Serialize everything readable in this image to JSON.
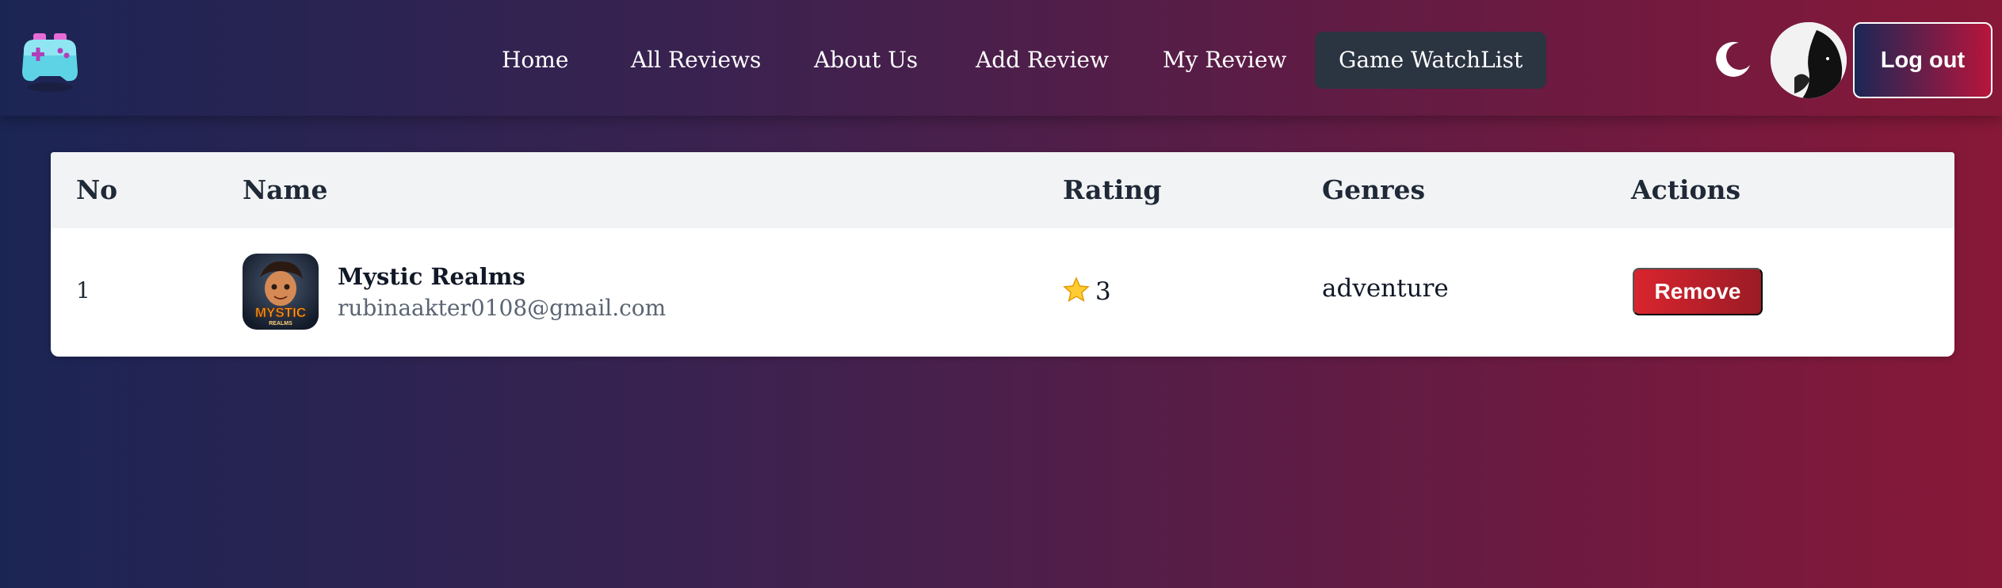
{
  "nav": {
    "links": [
      "Home",
      "All Reviews",
      "About Us",
      "Add Review",
      "My Review",
      "Game WatchList"
    ],
    "active": "Game WatchList",
    "logout_label": "Log out"
  },
  "table": {
    "headers": [
      "No",
      "Name",
      "Rating",
      "Genres",
      "Actions"
    ],
    "rows": [
      {
        "no": "1",
        "name": "Mystic Realms",
        "email": "rubinaakter0108@gmail.com",
        "thumb_text": "MYSTIC",
        "thumb_subtext": "REALMS",
        "rating": "3",
        "genre": "adventure",
        "action_label": "Remove"
      }
    ]
  },
  "icons": {
    "logo": "gamepad-icon",
    "theme_toggle": "moon-icon",
    "rating": "star-icon"
  },
  "colors": {
    "accent_red": "#d9252e",
    "nav_active_bg": "#2b3441"
  }
}
